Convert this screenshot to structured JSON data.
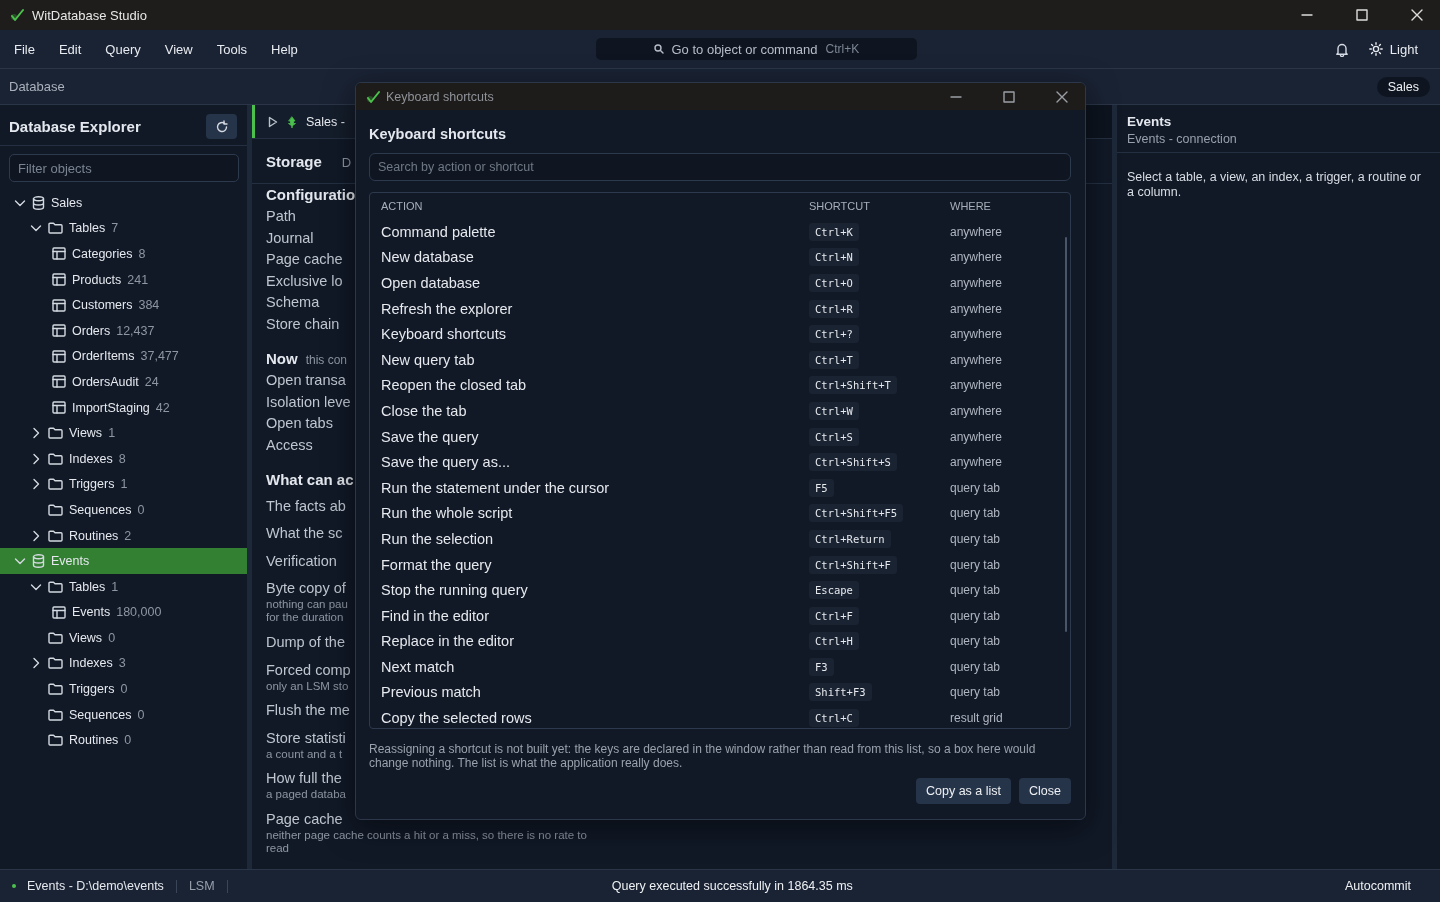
{
  "window": {
    "title": "WitDatabase Studio"
  },
  "menu": [
    "File",
    "Edit",
    "Query",
    "View",
    "Tools",
    "Help"
  ],
  "command_search": {
    "placeholder": "Go to object or command",
    "shortcut": "Ctrl+K"
  },
  "theme_button": {
    "label": "Light"
  },
  "breadcrumb": {
    "label": "Database",
    "connection": "Sales"
  },
  "explorer": {
    "title": "Database Explorer",
    "filter": {
      "placeholder": "Filter objects"
    },
    "tree": [
      {
        "kind": "database",
        "name": "Sales",
        "expanded": true,
        "selected": false,
        "children": [
          {
            "kind": "folder",
            "name": "Tables",
            "count": "7",
            "expanded": true,
            "selected": false,
            "children": [
              {
                "kind": "table",
                "name": "Categories",
                "count": "8",
                "selected": false
              },
              {
                "kind": "table",
                "name": "Products",
                "count": "241",
                "selected": false
              },
              {
                "kind": "table",
                "name": "Customers",
                "count": "384",
                "selected": false
              },
              {
                "kind": "table",
                "name": "Orders",
                "count": "12,437",
                "selected": false
              },
              {
                "kind": "table",
                "name": "OrderItems",
                "count": "37,477",
                "selected": false
              },
              {
                "kind": "table",
                "name": "OrdersAudit",
                "count": "24",
                "selected": false
              },
              {
                "kind": "table",
                "name": "ImportStaging",
                "count": "42",
                "selected": false
              }
            ]
          },
          {
            "kind": "folder",
            "name": "Views",
            "count": "1",
            "expanded": false,
            "selected": false
          },
          {
            "kind": "folder",
            "name": "Indexes",
            "count": "8",
            "expanded": false,
            "selected": false
          },
          {
            "kind": "folder",
            "name": "Triggers",
            "count": "1",
            "expanded": false,
            "selected": false
          },
          {
            "kind": "folder",
            "name": "Sequences",
            "count": "0",
            "selected": false
          },
          {
            "kind": "folder",
            "name": "Routines",
            "count": "2",
            "expanded": false,
            "selected": false
          }
        ]
      },
      {
        "kind": "database",
        "name": "Events",
        "expanded": true,
        "selected": true,
        "children": [
          {
            "kind": "folder",
            "name": "Tables",
            "count": "1",
            "expanded": true,
            "selected": false,
            "children": [
              {
                "kind": "table",
                "name": "Events",
                "count": "180,000",
                "selected": false
              }
            ]
          },
          {
            "kind": "folder",
            "name": "Views",
            "count": "0",
            "selected": false
          },
          {
            "kind": "folder",
            "name": "Indexes",
            "count": "3",
            "expanded": false,
            "selected": false
          },
          {
            "kind": "folder",
            "name": "Triggers",
            "count": "0",
            "selected": false
          },
          {
            "kind": "folder",
            "name": "Sequences",
            "count": "0",
            "selected": false
          },
          {
            "kind": "folder",
            "name": "Routines",
            "count": "0",
            "selected": false
          }
        ]
      }
    ]
  },
  "query_tab": {
    "label": "Sales -"
  },
  "info_panel": {
    "title": "Storage",
    "title_aside": "D",
    "sections": [
      {
        "title": "Configuratio",
        "rows": [
          {
            "label": "Path"
          },
          {
            "label": "Journal"
          },
          {
            "label": "Page cache"
          },
          {
            "label": "Exclusive lo"
          },
          {
            "label": "Schema"
          },
          {
            "label": "Store chain"
          }
        ]
      },
      {
        "title": "Now",
        "aside": "this con",
        "rows": [
          {
            "label": "Open transa"
          },
          {
            "label": "Isolation leve"
          },
          {
            "label": "Open tabs"
          },
          {
            "label": "Access"
          }
        ]
      },
      {
        "title": "What can ac",
        "rows": [
          {
            "label": "The facts ab"
          },
          {
            "label": "What the sc"
          },
          {
            "label": "Verification"
          },
          {
            "label": "Byte copy of",
            "note": "nothing can pau\nfor the duration"
          },
          {
            "label": "Dump of the"
          },
          {
            "label": "Forced comp",
            "note": "only an LSM sto"
          },
          {
            "label": "Flush the me"
          },
          {
            "label": "Store statisti",
            "note": "a count and a t"
          },
          {
            "label": "How full the",
            "note": "a paged databa"
          },
          {
            "label": "Page cache",
            "note": "neither page cache counts a hit or a miss, so there is no rate to read"
          }
        ]
      }
    ]
  },
  "details": {
    "title": "Events",
    "subtitle": "Events - connection",
    "text": "Select a table, a view, an index, a trigger, a routine or a column."
  },
  "dialog": {
    "window_title": "Keyboard shortcuts",
    "heading": "Keyboard shortcuts",
    "search": {
      "placeholder": "Search by action or shortcut"
    },
    "columns": [
      "ACTION",
      "SHORTCUT",
      "WHERE"
    ],
    "rows": [
      {
        "action": "Command palette",
        "shortcut": "Ctrl+K",
        "where": "anywhere"
      },
      {
        "action": "New database",
        "shortcut": "Ctrl+N",
        "where": "anywhere"
      },
      {
        "action": "Open database",
        "shortcut": "Ctrl+O",
        "where": "anywhere"
      },
      {
        "action": "Refresh the explorer",
        "shortcut": "Ctrl+R",
        "where": "anywhere"
      },
      {
        "action": "Keyboard shortcuts",
        "shortcut": "Ctrl+?",
        "where": "anywhere"
      },
      {
        "action": "New query tab",
        "shortcut": "Ctrl+T",
        "where": "anywhere"
      },
      {
        "action": "Reopen the closed tab",
        "shortcut": "Ctrl+Shift+T",
        "where": "anywhere"
      },
      {
        "action": "Close the tab",
        "shortcut": "Ctrl+W",
        "where": "anywhere"
      },
      {
        "action": "Save the query",
        "shortcut": "Ctrl+S",
        "where": "anywhere"
      },
      {
        "action": "Save the query as...",
        "shortcut": "Ctrl+Shift+S",
        "where": "anywhere"
      },
      {
        "action": "Run the statement under the cursor",
        "shortcut": "F5",
        "where": "query tab"
      },
      {
        "action": "Run the whole script",
        "shortcut": "Ctrl+Shift+F5",
        "where": "query tab"
      },
      {
        "action": "Run the selection",
        "shortcut": "Ctrl+Return",
        "where": "query tab"
      },
      {
        "action": "Format the query",
        "shortcut": "Ctrl+Shift+F",
        "where": "query tab"
      },
      {
        "action": "Stop the running query",
        "shortcut": "Escape",
        "where": "query tab"
      },
      {
        "action": "Find in the editor",
        "shortcut": "Ctrl+F",
        "where": "query tab"
      },
      {
        "action": "Replace in the editor",
        "shortcut": "Ctrl+H",
        "where": "query tab"
      },
      {
        "action": "Next match",
        "shortcut": "F3",
        "where": "query tab"
      },
      {
        "action": "Previous match",
        "shortcut": "Shift+F3",
        "where": "query tab"
      },
      {
        "action": "Copy the selected rows",
        "shortcut": "Ctrl+C",
        "where": "result grid"
      }
    ],
    "note": "Reassigning a shortcut is not built yet: the keys are declared in the window rather than read from this list, so a box here would change nothing. The list is what the application really does.",
    "buttons": [
      "Copy as a list",
      "Close"
    ]
  },
  "status_bar": {
    "connection": "Events - D:\\demo\\events",
    "engine": "LSM",
    "message": "Query executed successfully in 1864.35 ms",
    "mode": "Autocommit"
  }
}
